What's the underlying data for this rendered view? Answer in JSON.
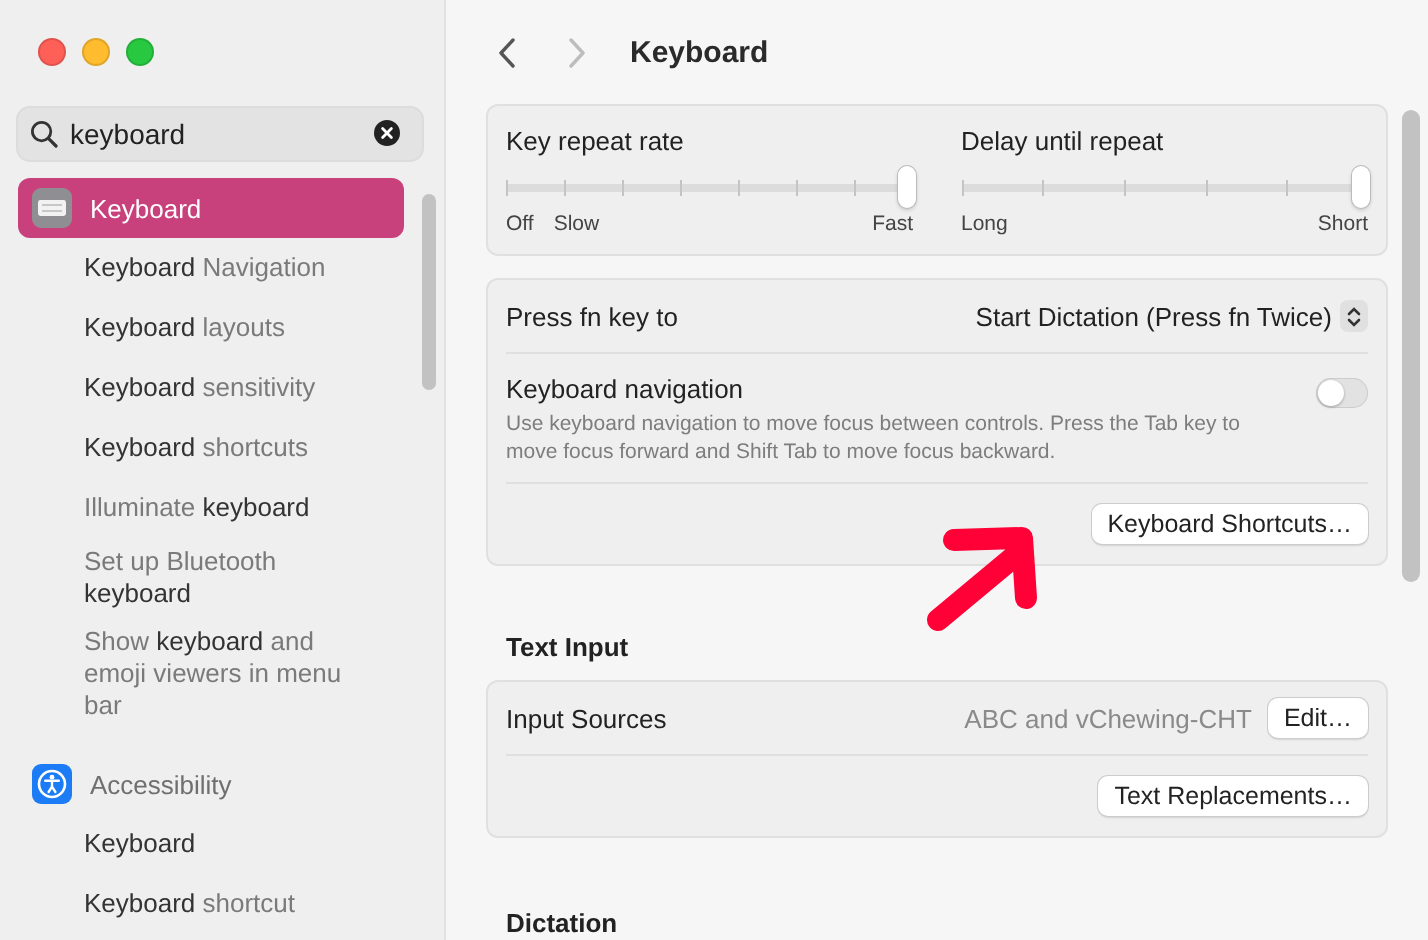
{
  "search": {
    "value": "keyboard"
  },
  "sidebar": {
    "sections": [
      {
        "label": "Keyboard",
        "selected": true,
        "children": [
          {
            "label": "**Keyboard** Navigation",
            "selected": false
          },
          {
            "label": "**Keyboard** layouts",
            "selected": false
          },
          {
            "label": "**Keyboard** sensitivity",
            "selected": false
          },
          {
            "label": "**Keyboard** shortcuts",
            "selected": false
          },
          {
            "label": "Illuminate **keyboard**",
            "selected": false
          },
          {
            "label": "Set up Bluetooth **keyboard**",
            "selected": false
          },
          {
            "label": "Show **keyboard** and emoji viewers in menu bar",
            "selected": false
          }
        ]
      },
      {
        "label": "Accessibility",
        "selected": false,
        "children": [
          {
            "label": "**Keyboard**",
            "selected": false
          },
          {
            "label": "**Keyboard** shortcut",
            "selected": false
          }
        ]
      }
    ]
  },
  "toolbar": {
    "title": "Keyboard",
    "back": {
      "disabled": false
    },
    "forward": {
      "disabled": true
    }
  },
  "sliders": [
    {
      "label": "Key repeat rate",
      "level": 1,
      "marks": [
        "Off",
        "Slow",
        "Fast"
      ]
    },
    {
      "label": "Delay until repeat",
      "level": 1,
      "marks": [
        "Long",
        "Short"
      ]
    }
  ],
  "keyboard_card": {
    "fn_row": {
      "label": "Press fn key to",
      "value": "Start Dictation (Press fn Twice)"
    },
    "navigation": {
      "label": "Keyboard navigation",
      "description": "Use keyboard navigation to move focus between controls. Press the Tab key to move focus forward and Shift Tab to move focus backward.",
      "on": false
    },
    "button": "Keyboard Shortcuts…"
  },
  "text_input": {
    "heading": "Text Input",
    "label": "Input Sources",
    "value": "ABC and vChewing-CHT",
    "edit_button": "Edit…",
    "replacements_button": "Text Replacements…"
  },
  "dictation": {
    "heading": "Dictation"
  }
}
